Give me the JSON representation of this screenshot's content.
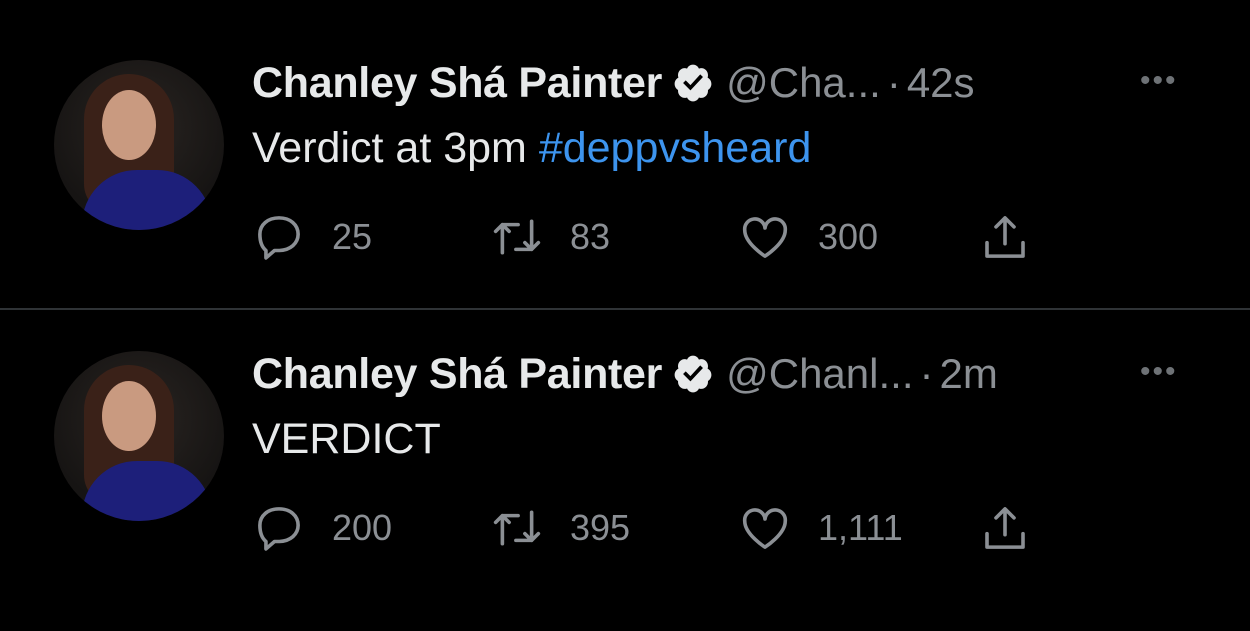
{
  "tweets": [
    {
      "name": "Chanley Shá Painter",
      "handle": "@Cha...",
      "separator": "·",
      "time": "42s",
      "more": "•••",
      "text": "Verdict at 3pm ",
      "hashtag": "#deppvsheard",
      "replies": "25",
      "retweets": "83",
      "likes": "300"
    },
    {
      "name": "Chanley Shá Painter",
      "handle": "@Chanl...",
      "separator": "·",
      "time": "2m",
      "more": "•••",
      "text": "VERDICT",
      "hashtag": "",
      "replies": "200",
      "retweets": "395",
      "likes": "1,111"
    }
  ],
  "colors": {
    "background": "#000000",
    "hashtag": "#3d94ee",
    "muted": "#8b8f94",
    "verified_badge": "#e7e9ea"
  },
  "icons": [
    "verified-badge-icon",
    "more-icon",
    "reply-icon",
    "retweet-icon",
    "like-icon",
    "share-icon"
  ]
}
